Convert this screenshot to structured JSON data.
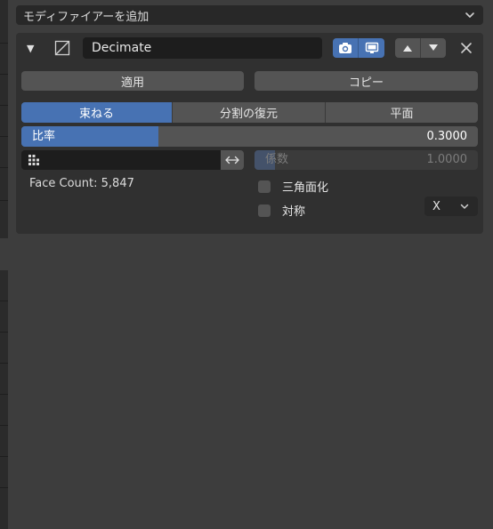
{
  "add_modifier": {
    "label": "モディファイアーを追加"
  },
  "modifier": {
    "name": "Decimate",
    "apply_label": "適用",
    "copy_label": "コピー",
    "modes": [
      {
        "label": "束ねる",
        "active": true
      },
      {
        "label": "分割の復元",
        "active": false
      },
      {
        "label": "平面",
        "active": false
      }
    ],
    "ratio": {
      "label": "比率",
      "value": "0.3000",
      "fraction": 0.3
    },
    "vertex_group": {
      "value": ""
    },
    "factor": {
      "label": "係数",
      "value": "1.0000",
      "fraction": 0.0
    },
    "face_count": "Face Count: 5,847",
    "triangulate": {
      "label": "三角面化",
      "checked": false
    },
    "symmetry": {
      "label": "対称",
      "checked": false,
      "axis": "X"
    }
  },
  "colors": {
    "accent": "#4772b3",
    "panel": "#303030",
    "background": "#3d3d3d",
    "button": "#545454",
    "field": "#1d1d1d"
  },
  "icons": [
    "chevron-down-icon",
    "disclosure-triangle-icon",
    "decimate-modifier-icon",
    "camera-icon",
    "monitor-icon",
    "move-up-icon",
    "move-down-icon",
    "close-icon",
    "vertex-group-icon",
    "invert-arrows-icon"
  ]
}
